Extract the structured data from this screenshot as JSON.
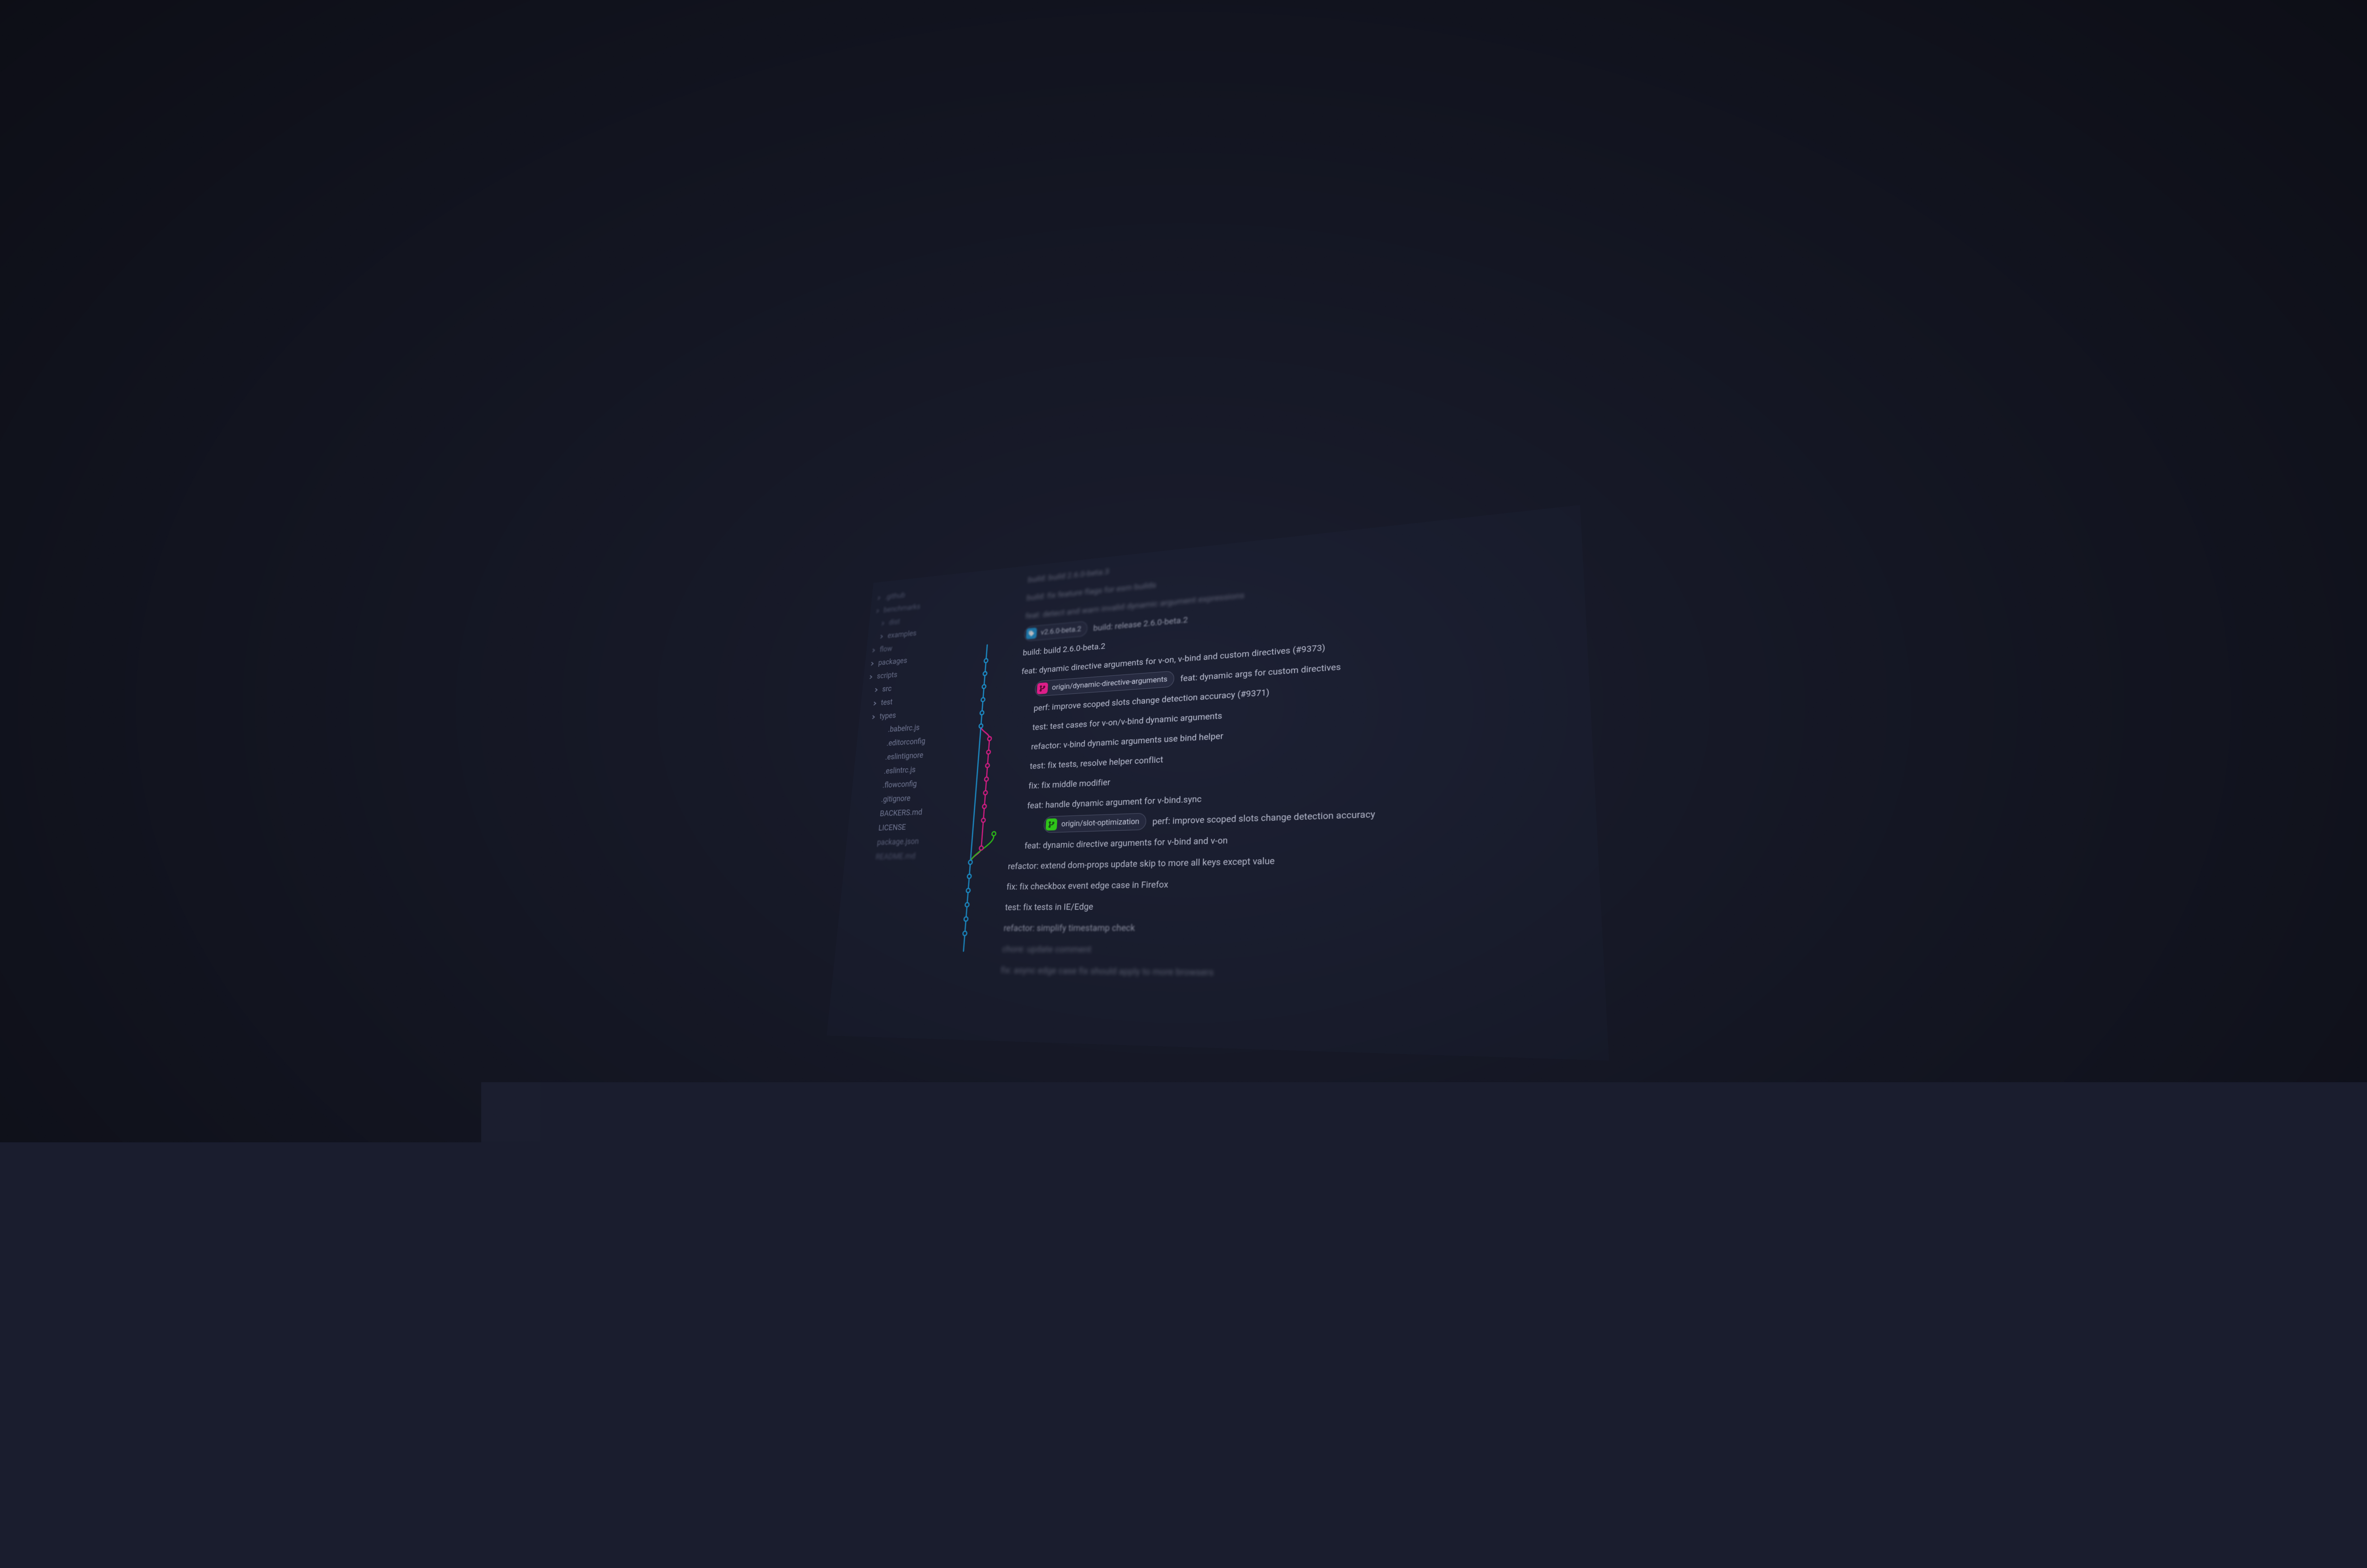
{
  "colors": {
    "blue": "#1e9bdc",
    "pink": "#e81f8f",
    "green": "#32d41a"
  },
  "sidebar": {
    "items": [
      {
        "label": ".github",
        "type": "folder",
        "depth": 0,
        "blur": 1
      },
      {
        "label": "benchmarks",
        "type": "folder",
        "depth": 0,
        "blur": 1
      },
      {
        "label": "dist",
        "type": "folder",
        "depth": 1,
        "blur": 1
      },
      {
        "label": "examples",
        "type": "folder",
        "depth": 1,
        "blur": 2
      },
      {
        "label": "flow",
        "type": "folder",
        "depth": 0,
        "blur": 2
      },
      {
        "label": "packages",
        "type": "folder",
        "depth": 0,
        "blur": 3
      },
      {
        "label": "scripts",
        "type": "folder",
        "depth": 0,
        "blur": 3
      },
      {
        "label": "src",
        "type": "folder",
        "depth": 1,
        "blur": 0
      },
      {
        "label": "test",
        "type": "folder",
        "depth": 1,
        "blur": 0
      },
      {
        "label": "types",
        "type": "folder",
        "depth": 1,
        "blur": 0
      },
      {
        "label": ".babelrc.js",
        "type": "file",
        "depth": 2,
        "blur": 0
      },
      {
        "label": ".editorconfig",
        "type": "file",
        "depth": 2,
        "blur": 0
      },
      {
        "label": ".eslintignore",
        "type": "file",
        "depth": 2,
        "blur": 0
      },
      {
        "label": ".eslintrc.js",
        "type": "file",
        "depth": 2,
        "blur": 0
      },
      {
        "label": ".flowconfig",
        "type": "file",
        "depth": 2,
        "blur": 0
      },
      {
        "label": ".gitignore",
        "type": "file",
        "depth": 2,
        "blur": 0
      },
      {
        "label": "BACKERS.md",
        "type": "file",
        "depth": 2,
        "blur": 0
      },
      {
        "label": "LICENSE",
        "type": "file",
        "depth": 2,
        "blur": 0
      },
      {
        "label": "package.json",
        "type": "file",
        "depth": 2,
        "blur": 2
      },
      {
        "label": "README.md",
        "type": "file",
        "depth": 2,
        "blur": 1
      }
    ]
  },
  "commits": [
    {
      "lane": "blue",
      "col": 0,
      "blur": "A",
      "msg": "build: build 2.6.0-beta.3"
    },
    {
      "lane": "blue",
      "col": 0,
      "blur": "A",
      "msg": "build: fix feature flags for esm builds"
    },
    {
      "lane": "blue",
      "col": 0,
      "blur": "A",
      "msg": "feat: detect and warn invalid dynamic argument expressions"
    },
    {
      "lane": "blue",
      "col": 0,
      "blur": "B",
      "tag": {
        "kind": "tag",
        "label": "v2.6.0-beta.2"
      },
      "msg": "build: release 2.6.0-beta.2"
    },
    {
      "lane": "blue",
      "col": 0,
      "blur": "",
      "msg": "build: build 2.6.0-beta.2"
    },
    {
      "lane": "blue",
      "col": 0,
      "blur": "",
      "msg": "feat: dynamic directive arguments for v-on, v-bind and custom directives (#9373)"
    },
    {
      "lane": "pink",
      "col": 1,
      "blur": "",
      "tag": {
        "kind": "pink",
        "label": "origin/dynamic-directive-arguments"
      },
      "msg": "feat: dynamic args for custom directives"
    },
    {
      "lane": "pink",
      "col": 1,
      "blur": "",
      "msg": "perf: improve scoped slots change detection accuracy (#9371)"
    },
    {
      "lane": "pink",
      "col": 1,
      "blur": "",
      "msg": "test: test cases for v-on/v-bind dynamic arguments"
    },
    {
      "lane": "pink",
      "col": 1,
      "blur": "",
      "msg": "refactor: v-bind dynamic arguments use bind helper"
    },
    {
      "lane": "pink",
      "col": 1,
      "blur": "",
      "msg": "test: fix tests, resolve helper conflict"
    },
    {
      "lane": "pink",
      "col": 1,
      "blur": "",
      "msg": "fix: fix middle modifier"
    },
    {
      "lane": "pink",
      "col": 1,
      "blur": "",
      "msg": "feat: handle dynamic argument for v-bind.sync"
    },
    {
      "lane": "green",
      "col": 2,
      "blur": "",
      "tag": {
        "kind": "green",
        "label": "origin/slot-optimization"
      },
      "msg": "perf: improve scoped slots change detection accuracy"
    },
    {
      "lane": "pink",
      "col": 1,
      "blur": "",
      "msg": "feat: dynamic directive arguments for v-bind and v-on"
    },
    {
      "lane": "blue",
      "col": 0,
      "blur": "",
      "msg": "refactor: extend dom-props update skip to more all keys except value"
    },
    {
      "lane": "blue",
      "col": 0,
      "blur": "",
      "msg": "fix: fix checkbox event edge case in Firefox"
    },
    {
      "lane": "blue",
      "col": 0,
      "blur": "",
      "msg": "test: fix tests in IE/Edge"
    },
    {
      "lane": "blue",
      "col": 0,
      "blur": "B",
      "msg": "refactor: simplify timestamp check"
    },
    {
      "lane": "blue",
      "col": 0,
      "blur": "A",
      "msg": "chore: update comment"
    },
    {
      "lane": "blue",
      "col": 0,
      "blur": "A",
      "msg": "fix: async edge case fix should apply to more browsers"
    }
  ]
}
